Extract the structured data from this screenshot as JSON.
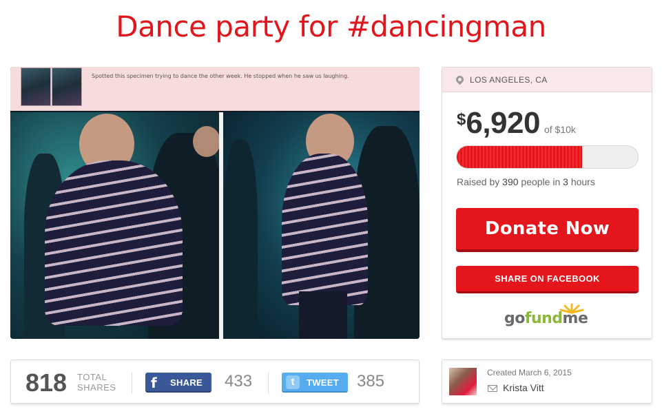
{
  "page": {
    "title": "Dance party for #dancingman"
  },
  "photo": {
    "caption": "Spotted this specimen trying to dance the other week. He stopped when he saw us laughing."
  },
  "campaign": {
    "location": "LOS ANGELES, CA",
    "currency_symbol": "$",
    "raised_amount": "6,920",
    "goal_text": "of $10k",
    "progress_fraction": 0.692,
    "raised_by_prefix": "Raised by",
    "people_count": "390",
    "people_text": "people in",
    "hours_count": "3",
    "hours_text": "hours",
    "donate_label": "Donate Now",
    "share_facebook_label": "SHARE ON FACEBOOK",
    "brand": {
      "go": "go",
      "fund": "fund",
      "me": "me"
    },
    "colors": {
      "accent_red": "#e4161b",
      "facebook_blue": "#3b5998",
      "twitter_blue": "#55acee",
      "brand_green": "#8bb838"
    }
  },
  "shares": {
    "total": "818",
    "total_label_line1": "TOTAL",
    "total_label_line2": "SHARES",
    "facebook_label": "SHARE",
    "facebook_icon": "f",
    "facebook_count": "433",
    "tweet_label": "TWEET",
    "tweet_icon": "t",
    "tweet_count": "385"
  },
  "creator": {
    "created_text": "Created March 6, 2015",
    "name": "Krista Vitt"
  }
}
